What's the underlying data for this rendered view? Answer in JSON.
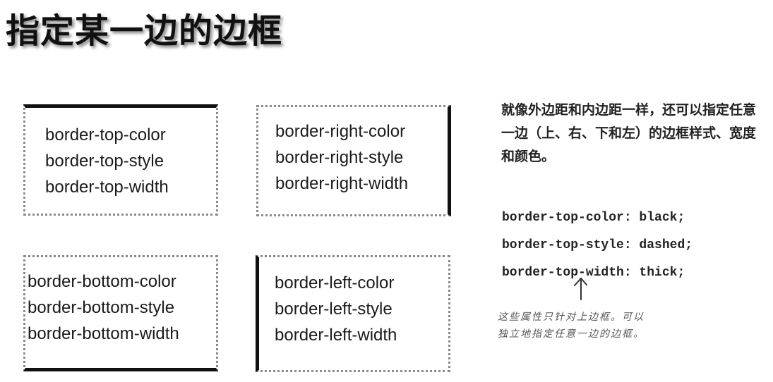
{
  "title": "指定某一边的边框",
  "boxes": [
    {
      "lines": [
        "border-top-color",
        "border-top-style",
        "border-top-width"
      ]
    },
    {
      "lines": [
        "border-right-color",
        "border-right-style",
        "border-right-width"
      ]
    },
    {
      "lines": [
        "border-bottom-color",
        "border-bottom-style",
        "border-bottom-width"
      ]
    },
    {
      "lines": [
        "border-left-color",
        "border-left-style",
        "border-left-width"
      ]
    }
  ],
  "description": "就像外边距和内边距一样，还可以指定任意一边（上、右、下和左）的边框样式、宽度和颜色。",
  "code": [
    "border-top-color: black;",
    "border-top-style: dashed;",
    "border-top-width: thick;"
  ],
  "annotation": {
    "icon": "up-arrow-icon",
    "lines": [
      "这些属性只针对上边框。可以",
      "独立地指定任意一边的边框。"
    ]
  }
}
